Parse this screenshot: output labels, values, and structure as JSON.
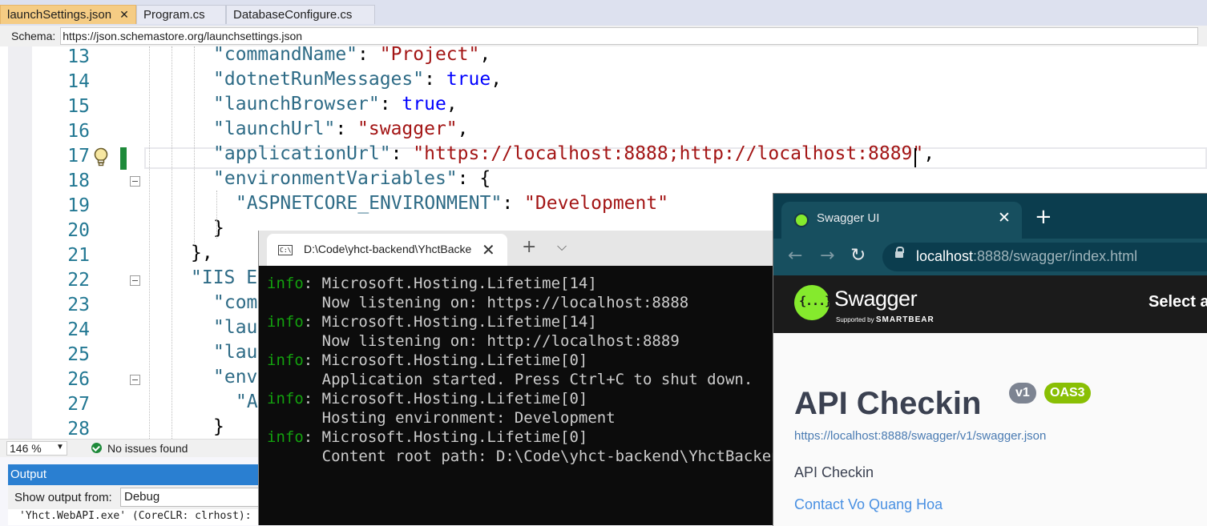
{
  "vs": {
    "tabs": [
      {
        "label": "launchSettings.json",
        "close": "✕"
      },
      {
        "label": "Program.cs"
      },
      {
        "label": "DatabaseConfigure.cs"
      }
    ],
    "schema_label": "Schema:",
    "schema_value": "https://json.schemastore.org/launchsettings.json",
    "code_lines": [
      {
        "num": "13",
        "parts": [
          {
            "t": "\"commandName\"",
            "c": "k"
          },
          {
            "t": ": "
          },
          {
            "t": "\"Project\"",
            "c": "s"
          },
          {
            "t": ","
          }
        ]
      },
      {
        "num": "14",
        "parts": [
          {
            "t": "\"dotnetRunMessages\"",
            "c": "k"
          },
          {
            "t": ": "
          },
          {
            "t": "true",
            "c": "b"
          },
          {
            "t": ","
          }
        ]
      },
      {
        "num": "15",
        "parts": [
          {
            "t": "\"launchBrowser\"",
            "c": "k"
          },
          {
            "t": ": "
          },
          {
            "t": "true",
            "c": "b"
          },
          {
            "t": ","
          }
        ]
      },
      {
        "num": "16",
        "parts": [
          {
            "t": "\"launchUrl\"",
            "c": "k"
          },
          {
            "t": ": "
          },
          {
            "t": "\"swagger\"",
            "c": "s"
          },
          {
            "t": ","
          }
        ]
      },
      {
        "num": "17",
        "parts": [
          {
            "t": "\"applicationUrl\"",
            "c": "k"
          },
          {
            "t": ": "
          },
          {
            "t": "\"https://localhost:8888;http://localhost:8889\"",
            "c": "s"
          },
          {
            "t": ","
          }
        ]
      },
      {
        "num": "18",
        "parts": [
          {
            "t": "\"environmentVariables\"",
            "c": "k"
          },
          {
            "t": ": {"
          }
        ]
      },
      {
        "num": "19",
        "parts": [
          {
            "t": "\"ASPNETCORE_ENVIRONMENT\"",
            "c": "k"
          },
          {
            "t": ": "
          },
          {
            "t": "\"Development\"",
            "c": "s"
          }
        ]
      },
      {
        "num": "20",
        "parts": [
          {
            "t": "}"
          }
        ]
      },
      {
        "num": "21",
        "parts": [
          {
            "t": "},"
          }
        ]
      },
      {
        "num": "22",
        "parts": [
          {
            "t": "\"IIS E",
            "c": "k"
          }
        ]
      },
      {
        "num": "23",
        "parts": [
          {
            "t": "\"com",
            "c": "k"
          }
        ]
      },
      {
        "num": "24",
        "parts": [
          {
            "t": "\"lau",
            "c": "k"
          }
        ]
      },
      {
        "num": "25",
        "parts": [
          {
            "t": "\"lau",
            "c": "k"
          }
        ]
      },
      {
        "num": "26",
        "parts": [
          {
            "t": "\"env",
            "c": "k"
          }
        ]
      },
      {
        "num": "27",
        "parts": [
          {
            "t": "\"A",
            "c": "k"
          }
        ]
      },
      {
        "num": "28",
        "parts": [
          {
            "t": "}"
          }
        ]
      }
    ],
    "zoom": "146 %",
    "zoom_arrow": "▼",
    "issues": "No issues found",
    "output_title": "Output",
    "output_from_label": "Show output from:",
    "output_from_value": "Debug",
    "output_text": "'Yhct.WebAPI.exe' (CoreCLR: clrhost):"
  },
  "terminal": {
    "title": "D:\\Code\\yhct-backend\\YhctBackend",
    "icon": "C:\\",
    "close": "✕",
    "new_tab": "+",
    "dropdown": "⌵",
    "lines": [
      {
        "prefix": "info",
        "text": ": Microsoft.Hosting.Lifetime[14]"
      },
      {
        "prefix": "",
        "text": "      Now listening on: https://localhost:8888"
      },
      {
        "prefix": "info",
        "text": ": Microsoft.Hosting.Lifetime[14]"
      },
      {
        "prefix": "",
        "text": "      Now listening on: http://localhost:8889"
      },
      {
        "prefix": "info",
        "text": ": Microsoft.Hosting.Lifetime[0]"
      },
      {
        "prefix": "",
        "text": "      Application started. Press Ctrl+C to shut down."
      },
      {
        "prefix": "info",
        "text": ": Microsoft.Hosting.Lifetime[0]"
      },
      {
        "prefix": "",
        "text": "      Hosting environment: Development"
      },
      {
        "prefix": "info",
        "text": ": Microsoft.Hosting.Lifetime[0]"
      },
      {
        "prefix": "",
        "text": "      Content root path: D:\\Code\\yhct-backend\\YhctBackend"
      }
    ]
  },
  "browser": {
    "tab_title": "Swagger UI",
    "tab_close": "✕",
    "new_tab": "+",
    "back": "←",
    "forward": "→",
    "reload": "↻",
    "url_host": "localhost",
    "url_rest": ":8888/swagger/index.html"
  },
  "swagger": {
    "brand": "Swagger",
    "supported_by": "Supported by",
    "smartbear": "SMARTBEAR",
    "select_label": "Select a definition",
    "api_title": "API Checkin",
    "version_badge": "v1",
    "oas_badge": "OAS3",
    "spec_link": "https://localhost:8888/swagger/v1/swagger.json",
    "description": "API Checkin",
    "contact": "Contact Vo Quang Hoa"
  }
}
